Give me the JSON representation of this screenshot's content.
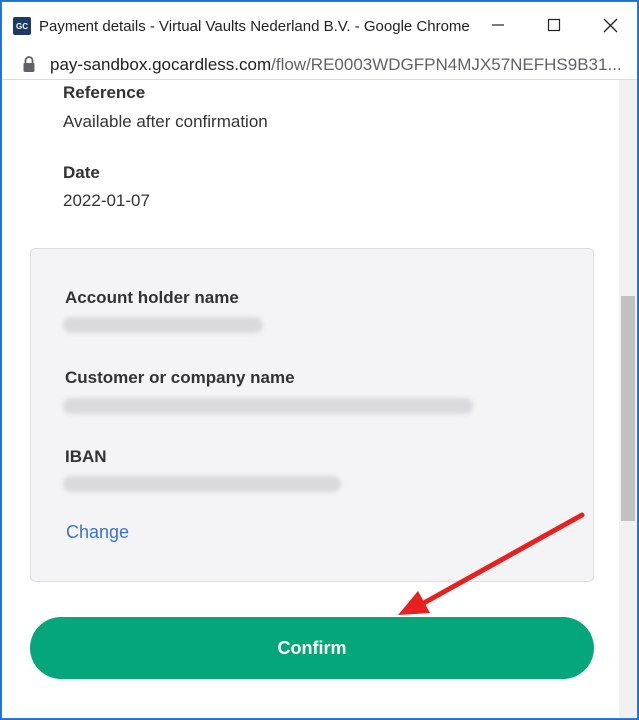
{
  "window": {
    "favicon_text": "GC",
    "title": "Payment details - Virtual Vaults Nederland B.V. - Google Chrome"
  },
  "address": {
    "host": "pay-sandbox.gocardless.com",
    "path": "/flow/RE0003WDGFPN4MJX57NEFHS9B31..."
  },
  "details": {
    "reference_label": "Reference",
    "reference_value": "Available after confirmation",
    "date_label": "Date",
    "date_value": "2022-01-07"
  },
  "account": {
    "holder_label": "Account holder name",
    "company_label": "Customer or company name",
    "iban_label": "IBAN",
    "change_label": "Change"
  },
  "confirm_label": "Confirm",
  "colors": {
    "accent": "#06a67b",
    "link": "#3c74c9",
    "annotation_arrow": "#e8201f"
  },
  "icons": [
    "lock-icon",
    "minimize-icon",
    "maximize-icon",
    "close-icon",
    "arrow-annotation-icon"
  ]
}
